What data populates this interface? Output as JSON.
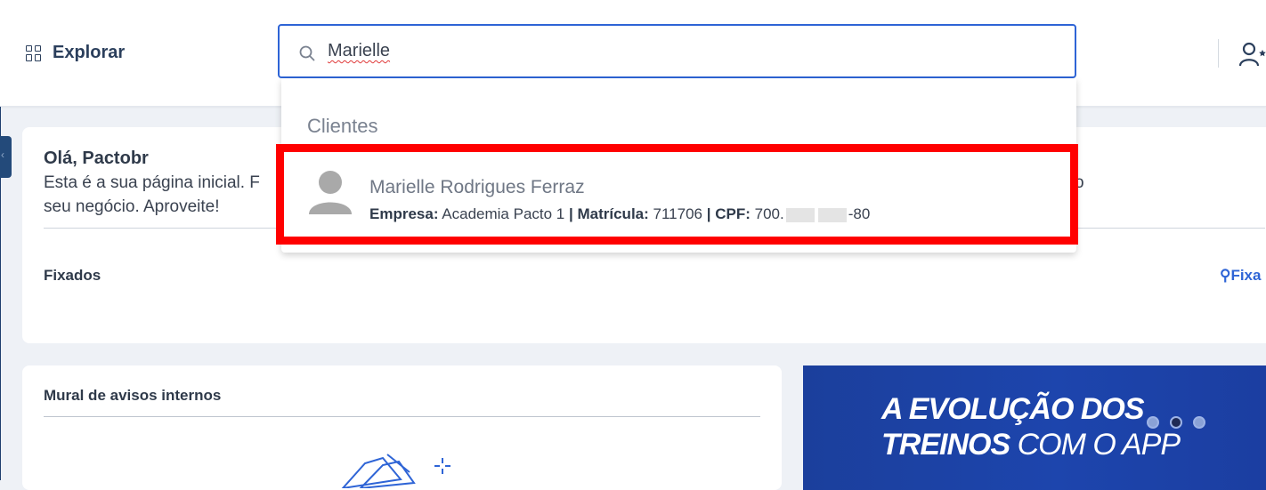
{
  "header": {
    "explore_label": "Explorar",
    "search_value": "Marielle"
  },
  "welcome": {
    "title": "Olá, Pactobr",
    "line1": "Esta é a sua página inicial. F",
    "line1_tail": "o",
    "line2": "seu negócio. Aproveite!"
  },
  "pinned": {
    "title": "Fixados",
    "link_label": "Fixa"
  },
  "mural": {
    "title": "Mural de avisos internos"
  },
  "banner": {
    "line1": "A EVOLUÇÃO DOS",
    "line2_bold": "TREINOS",
    "line2_rest": "COM O APP",
    "active_dot": 1
  },
  "search_results": {
    "section": "Clientes",
    "items": [
      {
        "name": "Marielle Rodrigues Ferraz",
        "empresa_label": "Empresa:",
        "empresa": "Academia Pacto 1",
        "sep": "|",
        "matricula_label": "Matrícula:",
        "matricula": "711706",
        "cpf_label": "CPF:",
        "cpf_prefix": "700.",
        "cpf_suffix": "-80"
      }
    ]
  },
  "colors": {
    "accent": "#2e64d6",
    "highlight": "#ff0000",
    "banner": "#1d45ad"
  }
}
